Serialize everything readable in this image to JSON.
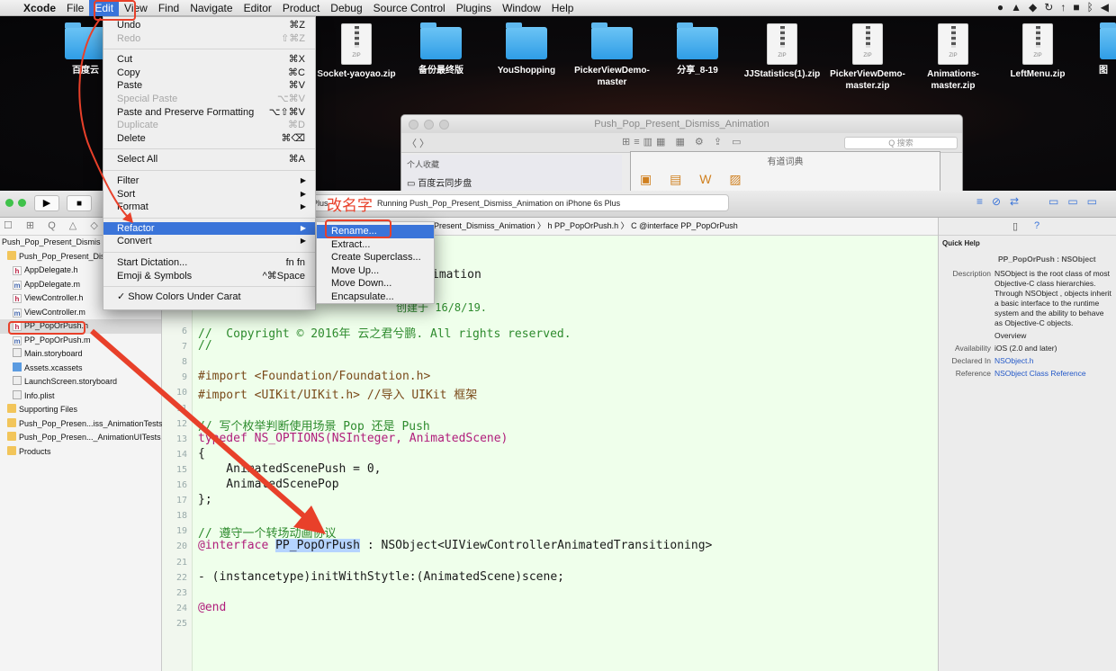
{
  "menubar": {
    "apple": "",
    "items": [
      "Xcode",
      "File",
      "Edit",
      "View",
      "Find",
      "Navigate",
      "Editor",
      "Product",
      "Debug",
      "Source Control",
      "Plugins",
      "Window",
      "Help"
    ],
    "active": "Edit"
  },
  "desktop": {
    "icons": [
      {
        "label": "Socket-yaoyao.zip",
        "type": "zip"
      },
      {
        "label": "备份最终版",
        "type": "folder"
      },
      {
        "label": "YouShopping",
        "type": "folder"
      },
      {
        "label": "PickerViewDemo-master",
        "type": "folder"
      },
      {
        "label": "分享_8-19",
        "type": "folder"
      },
      {
        "label": "JJStatistics(1).zip",
        "type": "zip"
      },
      {
        "label": "PickerViewDemo-master.zip",
        "type": "zip"
      },
      {
        "label": "Animations-master.zip",
        "type": "zip"
      },
      {
        "label": "LeftMenu.zip",
        "type": "zip"
      },
      {
        "label": "图",
        "type": "folder"
      }
    ],
    "left_label": "百度云",
    "zip_tag": "ZIP"
  },
  "finder": {
    "title": "Push_Pop_Present_Dismiss_Animation",
    "search_placeholder": "Q 搜索",
    "sidebar_header": "个人收藏",
    "sidebar_item": "百度云同步盘"
  },
  "youdao": {
    "title": "有道词典"
  },
  "xcode": {
    "run_prefix": "Plus",
    "run_status": "Running Push_Pop_Present_Dismiss_Animation on iPhone 6s Plus",
    "jump_bar": "Present_Dismiss_Animation 〉 h  PP_PopOrPush.h 〉 C  @interface PP_PopOrPush",
    "navigator_icons": "☐ ⊞ Q △ ◇ ≡",
    "navigator": [
      {
        "label": "Push_Pop_Present_Dismis",
        "icon": "",
        "indent": 0
      },
      {
        "label": "Push_Pop_Present_Dism",
        "icon": "f",
        "indent": 1
      },
      {
        "label": "AppDelegate.h",
        "icon": "h",
        "indent": 2
      },
      {
        "label": "AppDelegate.m",
        "icon": "m",
        "indent": 2
      },
      {
        "label": "ViewController.h",
        "icon": "h",
        "indent": 2
      },
      {
        "label": "ViewController.m",
        "icon": "m",
        "indent": 2
      },
      {
        "label": "PP_PopOrPush.h",
        "icon": "h",
        "indent": 2
      },
      {
        "label": "PP_PopOrPush.m",
        "icon": "m",
        "indent": 2
      },
      {
        "label": "Main.storyboard",
        "icon": "sb",
        "indent": 2
      },
      {
        "label": "Assets.xcassets",
        "icon": "as",
        "indent": 2
      },
      {
        "label": "LaunchScreen.storyboard",
        "icon": "sb",
        "indent": 2
      },
      {
        "label": "Info.plist",
        "icon": "pl",
        "indent": 2
      },
      {
        "label": "Supporting Files",
        "icon": "f",
        "indent": 1
      },
      {
        "label": "Push_Pop_Presen...iss_AnimationTests",
        "icon": "f",
        "indent": 1
      },
      {
        "label": "Push_Pop_Presen..._AnimationUITests",
        "icon": "f",
        "indent": 1
      },
      {
        "label": "Products",
        "icon": "f",
        "indent": 1
      }
    ]
  },
  "code": {
    "partial_line_3": "imation",
    "partial_line_5": "创建于 16/8/19.",
    "lines": [
      {
        "n": "6",
        "text": "//  Copyright © 2016年 云之君兮鹏. All rights reserved."
      },
      {
        "n": "7",
        "text": "//"
      },
      {
        "n": "8",
        "text": ""
      },
      {
        "n": "9",
        "text": "#import <Foundation/Foundation.h>"
      },
      {
        "n": "10",
        "text": "#import <UIKit/UIKit.h> //导入 UIKit 框架"
      },
      {
        "n": "11",
        "text": ""
      },
      {
        "n": "12",
        "text": "// 写个枚举判断使用场景 Pop 还是 Push"
      },
      {
        "n": "13",
        "text": "typedef NS_OPTIONS(NSInteger, AnimatedScene)"
      },
      {
        "n": "14",
        "text": "{"
      },
      {
        "n": "15",
        "text": "    AnimatedScenePush = 0,"
      },
      {
        "n": "16",
        "text": "    AnimatedScenePop"
      },
      {
        "n": "17",
        "text": "};"
      },
      {
        "n": "18",
        "text": ""
      },
      {
        "n": "19",
        "text": "// 遵守一个转场动画协议"
      },
      {
        "n": "20",
        "text": "@interface PP_PopOrPush : NSObject<UIViewControllerAnimatedTransitioning>"
      },
      {
        "n": "21",
        "text": ""
      },
      {
        "n": "22",
        "text": "- (instancetype)initWithStytle:(AnimatedScene)scene;"
      },
      {
        "n": "23",
        "text": ""
      },
      {
        "n": "24",
        "text": "@end"
      },
      {
        "n": "25",
        "text": ""
      }
    ]
  },
  "edit_menu": [
    {
      "label": "Undo",
      "shortcut": "⌘Z",
      "enabled": true
    },
    {
      "label": "Redo",
      "shortcut": "⇧⌘Z",
      "enabled": false
    },
    {
      "sep": true
    },
    {
      "label": "Cut",
      "shortcut": "⌘X",
      "enabled": true
    },
    {
      "label": "Copy",
      "shortcut": "⌘C",
      "enabled": true
    },
    {
      "label": "Paste",
      "shortcut": "⌘V",
      "enabled": true
    },
    {
      "label": "Special Paste",
      "shortcut": "⌥⌘V",
      "enabled": false
    },
    {
      "label": "Paste and Preserve Formatting",
      "shortcut": "⌥⇧⌘V",
      "enabled": true
    },
    {
      "label": "Duplicate",
      "shortcut": "⌘D",
      "enabled": false
    },
    {
      "label": "Delete",
      "shortcut": "⌘⌫",
      "enabled": true
    },
    {
      "sep": true
    },
    {
      "label": "Select All",
      "shortcut": "⌘A",
      "enabled": true
    },
    {
      "sep": true
    },
    {
      "label": "Filter",
      "shortcut": "",
      "enabled": true,
      "submenu": true
    },
    {
      "label": "Sort",
      "shortcut": "",
      "enabled": true,
      "submenu": true
    },
    {
      "label": "Format",
      "shortcut": "",
      "enabled": true,
      "submenu": true
    },
    {
      "sep": true
    },
    {
      "label": "Refactor",
      "shortcut": "",
      "enabled": true,
      "submenu": true,
      "highlight": true
    },
    {
      "label": "Convert",
      "shortcut": "",
      "enabled": true,
      "submenu": true
    },
    {
      "sep": true
    },
    {
      "label": "Start Dictation...",
      "shortcut": "fn fn",
      "enabled": true
    },
    {
      "label": "Emoji & Symbols",
      "shortcut": "^⌘Space",
      "enabled": true
    },
    {
      "sep": true
    },
    {
      "label": "✓ Show Colors Under Carat",
      "shortcut": "",
      "enabled": true
    }
  ],
  "refactor_menu": [
    "Rename...",
    "Extract...",
    "Create Superclass...",
    "Move Up...",
    "Move Down...",
    "Encapsulate..."
  ],
  "annotation": {
    "rename_note": "改名字"
  },
  "quick_help": {
    "header": "Quick Help",
    "symbol": "PP_PopOrPush : NSObject",
    "rows": [
      {
        "k": "Description",
        "v": "NSObject is the root class of most Objective-C class hierarchies. Through NSObject , objects inherit a basic interface to the runtime system and the ability to behave as Objective-C objects."
      },
      {
        "k": "",
        "v": "Overview"
      },
      {
        "k": "Availability",
        "v": "iOS (2.0 and later)"
      },
      {
        "k": "Declared In",
        "v": "NSObject.h"
      },
      {
        "k": "Reference",
        "v": "NSObject Class Reference"
      }
    ]
  },
  "colors": {
    "accent": "#3a74d9",
    "annotation": "#e8402a",
    "editor_bg": "#efffeb"
  }
}
